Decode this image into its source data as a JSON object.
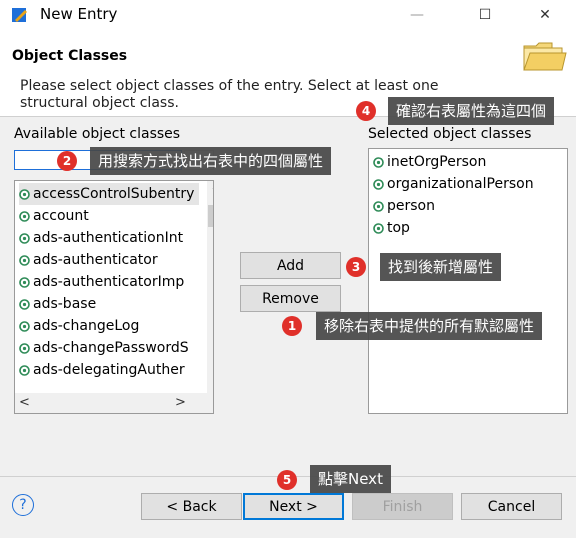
{
  "window": {
    "title": "New Entry",
    "minimize_glyph": "—",
    "maximize_glyph": "☐",
    "close_glyph": "✕"
  },
  "header": {
    "title": "Object Classes",
    "description": "Please select object classes of the entry. Select at least one structural object class."
  },
  "available": {
    "label": "Available object classes",
    "filter_value": "",
    "items": [
      "accessControlSubentry",
      "account",
      "ads-authenticationInt",
      "ads-authenticator",
      "ads-authenticatorImp",
      "ads-base",
      "ads-changeLog",
      "ads-changePasswordS",
      "ads-delegatingAuther"
    ],
    "scroll_left": "<",
    "scroll_right": ">",
    "scroll_up": "^",
    "scroll_down": "v"
  },
  "selected": {
    "label": "Selected object classes",
    "items": [
      "inetOrgPerson",
      "organizationalPerson",
      "person",
      "top"
    ]
  },
  "buttons": {
    "add": "Add",
    "remove": "Remove",
    "help": "?",
    "back": "< Back",
    "next": "Next >",
    "finish": "Finish",
    "cancel": "Cancel"
  },
  "annotations": {
    "a1": {
      "number": "1",
      "text": "移除右表中提供的所有默認屬性"
    },
    "a2": {
      "number": "2",
      "text": "用搜索方式找出右表中的四個屬性"
    },
    "a3": {
      "number": "3",
      "text": "找到後新增屬性"
    },
    "a4": {
      "number": "4",
      "text": "確認右表屬性為這四個"
    },
    "a5": {
      "number": "5",
      "text": "點擊Next"
    }
  },
  "colors": {
    "accent": "#0078d7",
    "badge": "#e0302a",
    "callout_bg": "#464646",
    "icon_green": "#2e8b57"
  }
}
